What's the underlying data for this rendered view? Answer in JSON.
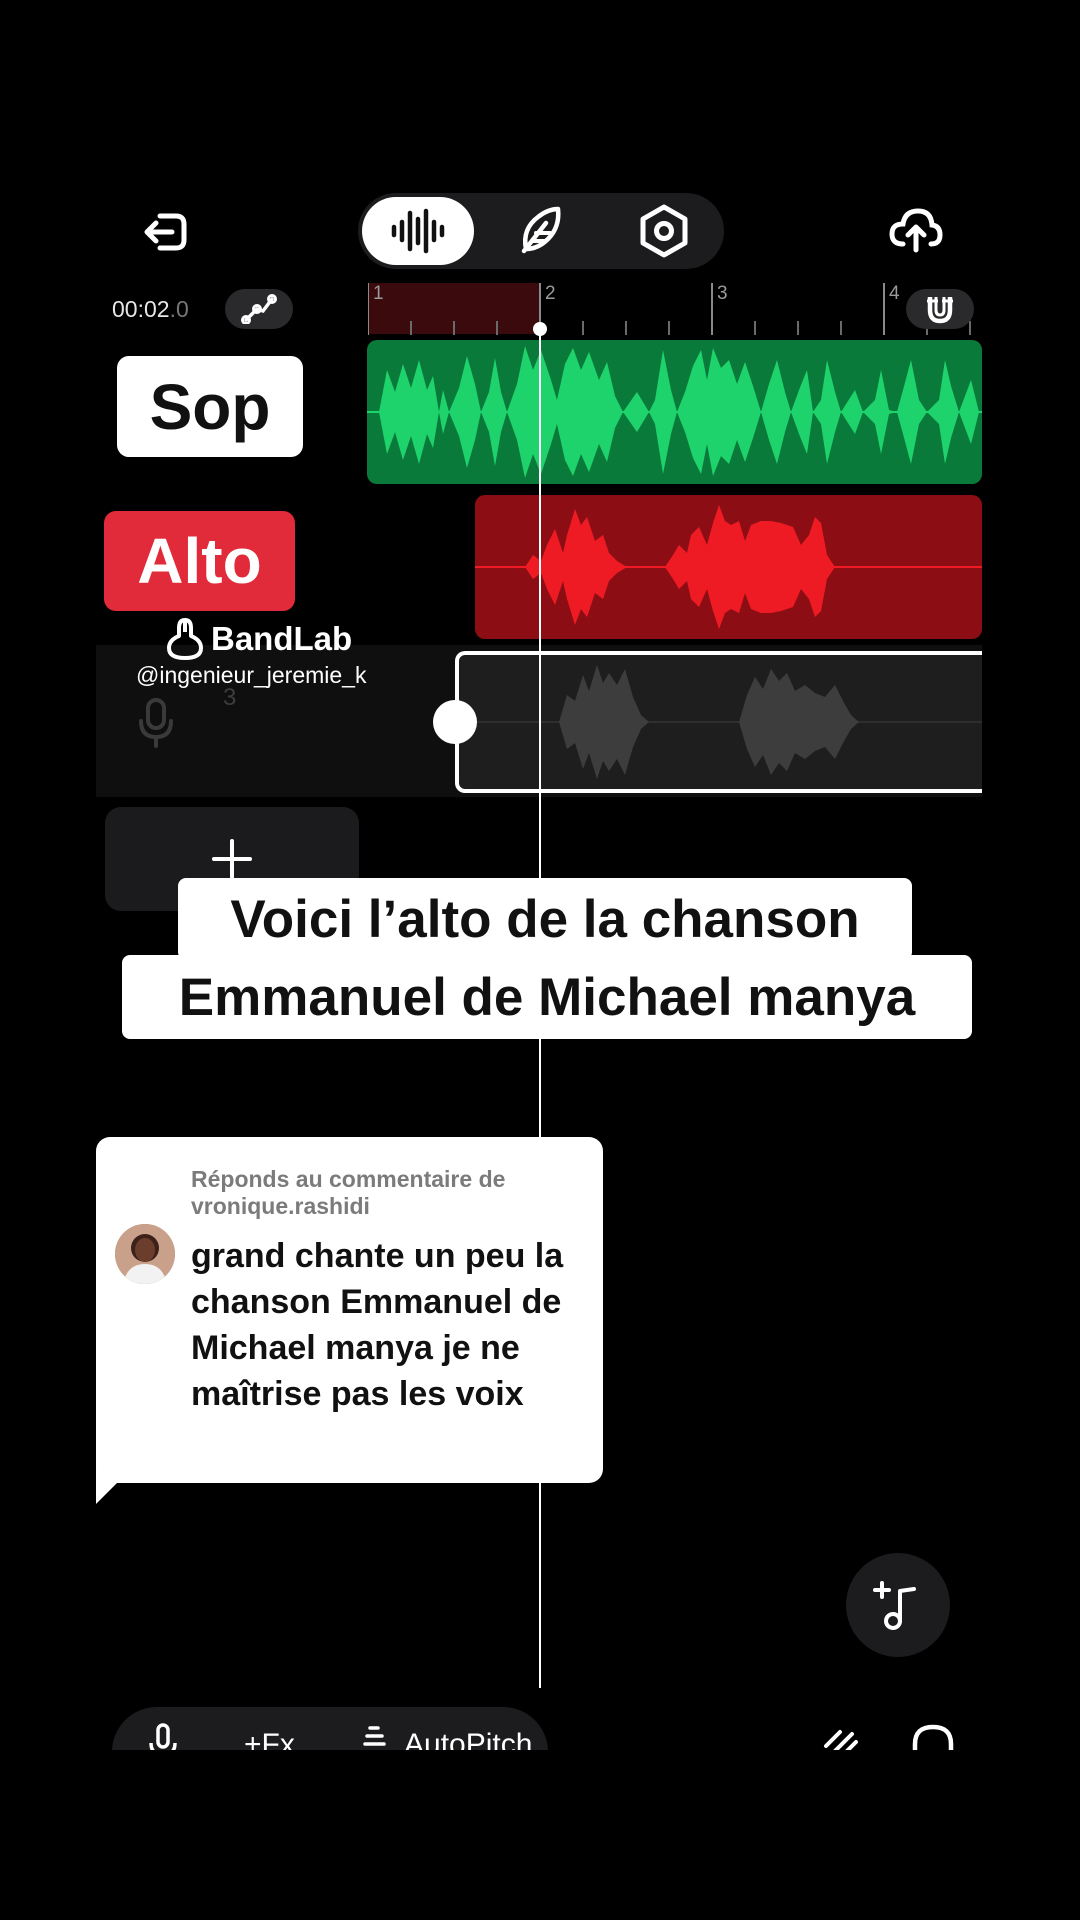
{
  "toolbar": {
    "back_icon": "back-exit-icon",
    "tabs": [
      {
        "name": "waveform-tab",
        "icon": "waveform-icon",
        "active": true
      },
      {
        "name": "feather-tab",
        "icon": "feather-icon",
        "active": false
      },
      {
        "name": "settings-tab",
        "icon": "hexagon-settings-icon",
        "active": false
      }
    ],
    "upload_icon": "cloud-upload-icon"
  },
  "timeline": {
    "time_main": "00:02",
    "time_frac": ".0",
    "ruler_marks": [
      "1",
      "2",
      "3",
      "4"
    ]
  },
  "tracks": [
    {
      "label": "Sop",
      "color": "#0a7a3a",
      "wave_color": "#1ed36b"
    },
    {
      "label": "Alto",
      "color": "#8c0e14",
      "wave_color": "#ef1b24"
    },
    {
      "label": "3",
      "color": "#1e1e1e",
      "wave_color": "#3d3d3d"
    }
  ],
  "watermark": {
    "brand": "BandLab",
    "handle": "@ingenieur_jeremie_k"
  },
  "caption": {
    "line1": "Voici l’alto de la chanson",
    "line2": "Emmanuel de Michael manya"
  },
  "reply": {
    "header": "Réponds au commentaire de vronique.rashidi",
    "body": "grand chante un peu la chanson Emmanuel de Michael manya je ne maîtrise pas les voix"
  },
  "bottom_bar": {
    "items": [
      "+Fx",
      "AutoPitch"
    ]
  },
  "colors": {
    "accent_sop": "#1ed36b",
    "accent_alto": "#e12a3a",
    "background": "#000000"
  }
}
